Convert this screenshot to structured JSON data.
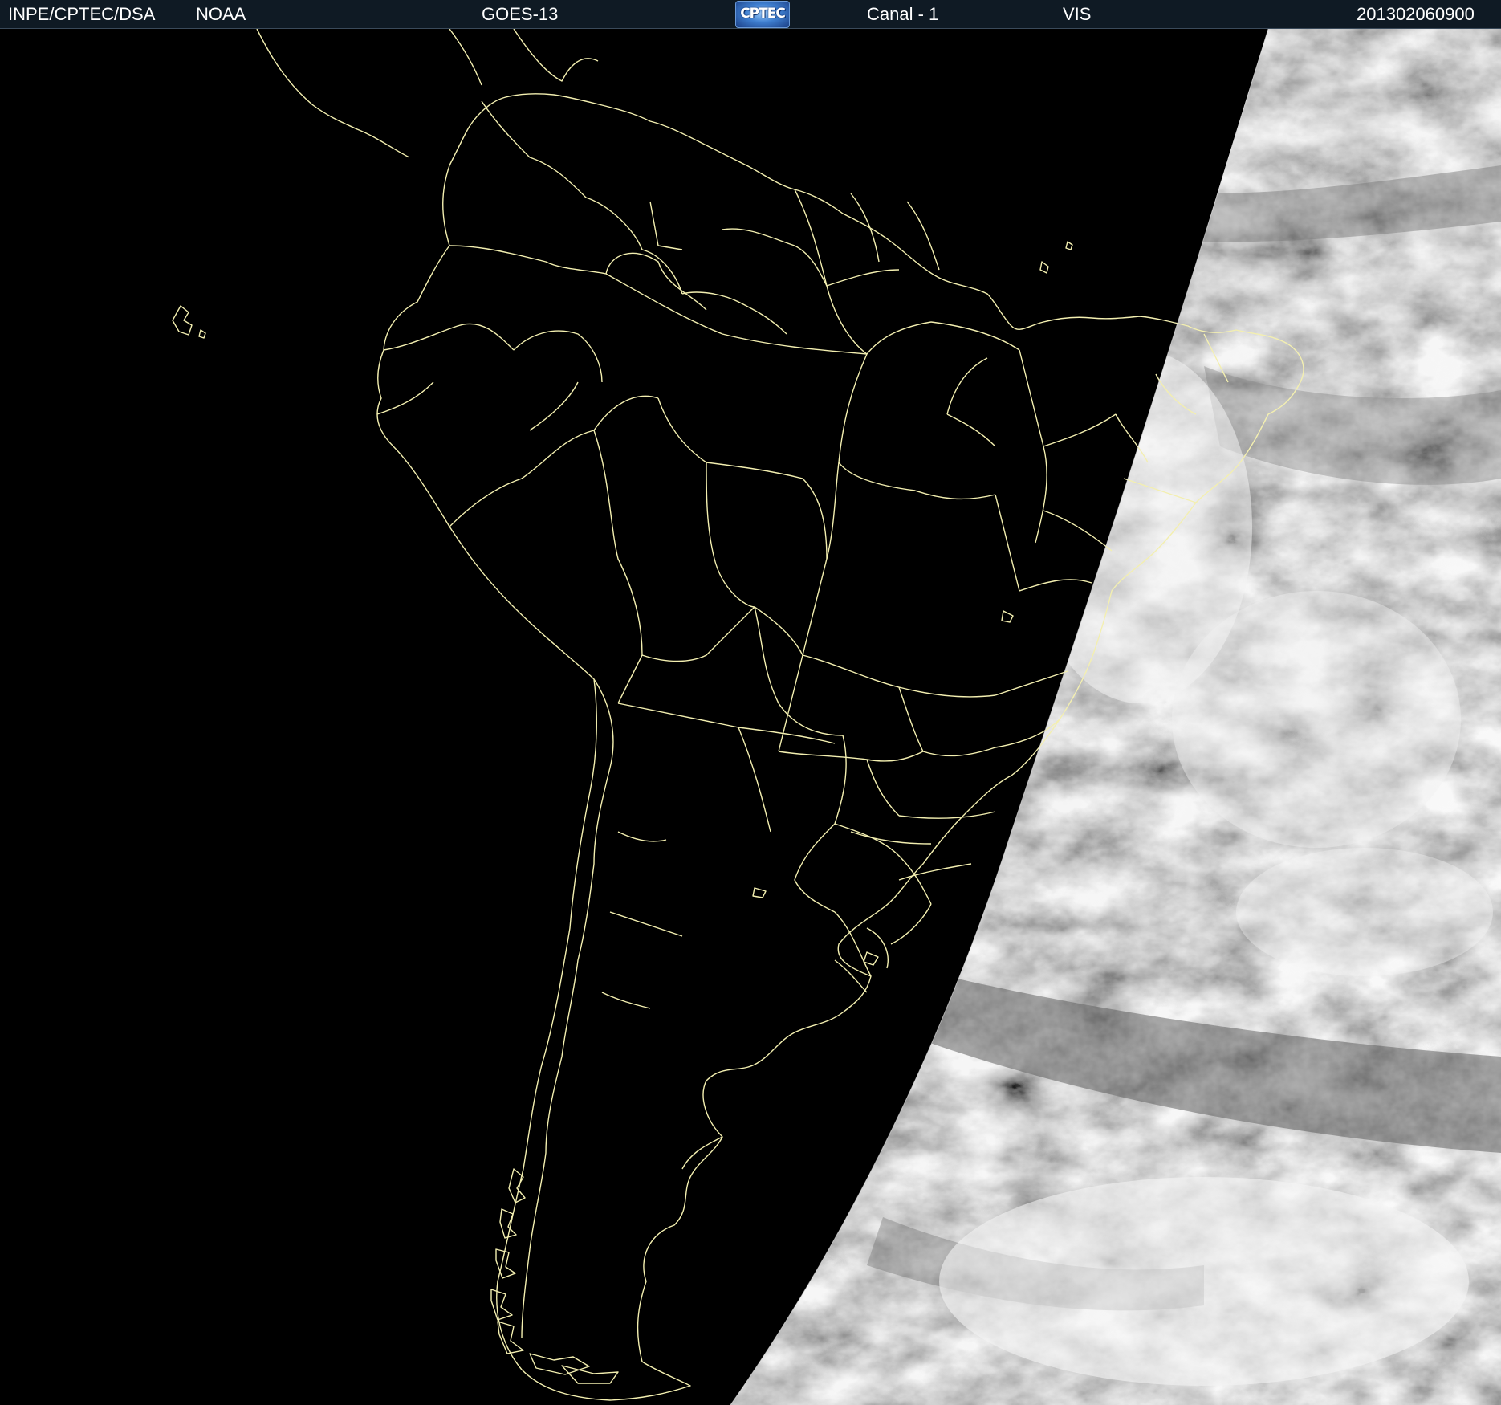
{
  "header": {
    "agency": "INPE/CPTEC/DSA",
    "source": "NOAA",
    "satellite": "GOES-13",
    "logo_text": "CPTEC",
    "channel": "Canal - 1",
    "band": "VIS",
    "datetime": "201302060900"
  },
  "map": {
    "background_color": "#000000",
    "border_color": "#f3efb0",
    "cloud_light": "#e8e8e8",
    "cloud_mid": "#a9a9a9",
    "cloud_dark": "#6a6a6a"
  }
}
